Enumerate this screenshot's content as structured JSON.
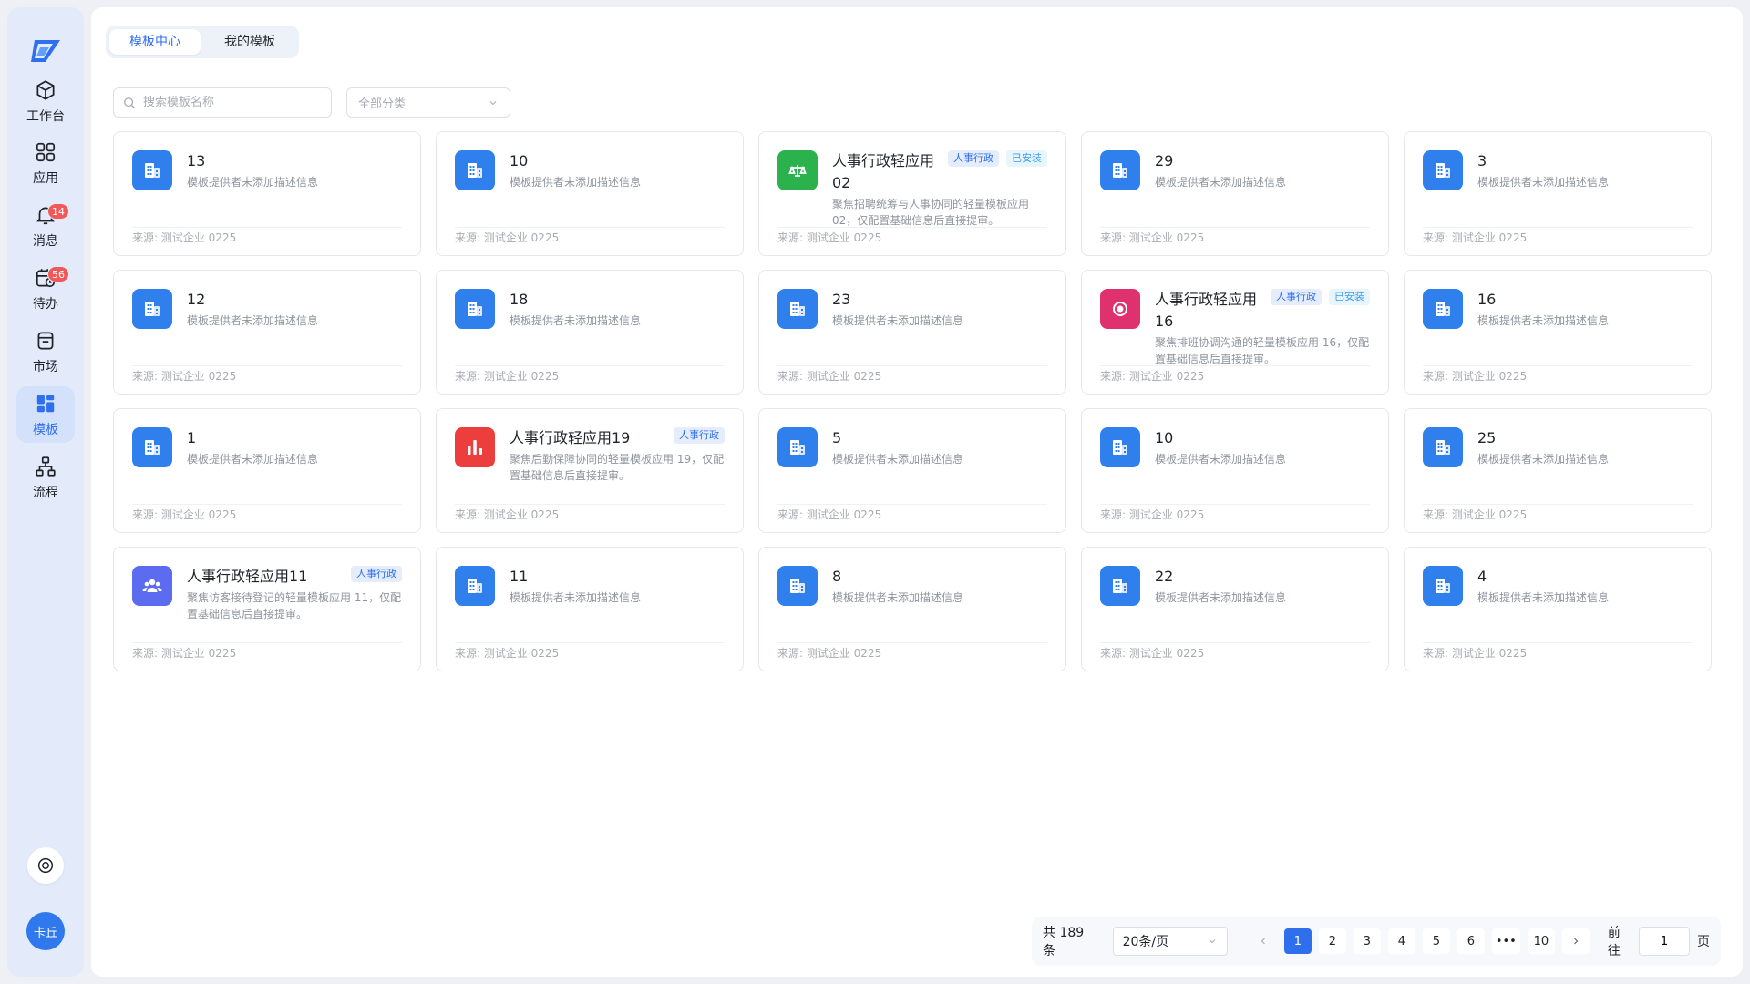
{
  "sidebar": {
    "items": [
      {
        "label": "工作台",
        "icon": "cube-icon"
      },
      {
        "label": "应用",
        "icon": "grid-apps-icon"
      },
      {
        "label": "消息",
        "icon": "bell-icon",
        "badge": "14"
      },
      {
        "label": "待办",
        "icon": "calendar-clock-icon",
        "badge": "56"
      },
      {
        "label": "市场",
        "icon": "store-icon"
      },
      {
        "label": "模板",
        "icon": "template-icon",
        "active": true
      },
      {
        "label": "流程",
        "icon": "flow-icon"
      }
    ],
    "avatar": "卡丘"
  },
  "tabs": [
    {
      "label": "模板中心",
      "active": true
    },
    {
      "label": "我的模板",
      "active": false
    }
  ],
  "search": {
    "placeholder": "搜索模板名称"
  },
  "category": {
    "placeholder": "全部分类"
  },
  "cards": [
    {
      "title": "13",
      "desc": "模板提供者未添加描述信息",
      "source": "来源: 测试企业 0225",
      "icon": "building-icon",
      "color": "#2f80ed"
    },
    {
      "title": "10",
      "desc": "模板提供者未添加描述信息",
      "source": "来源: 测试企业 0225",
      "icon": "building-icon",
      "color": "#2f80ed"
    },
    {
      "title": "人事行政轻应用 02",
      "desc": "聚焦招聘统筹与人事协同的轻量模板应用 02，仅配置基础信息后直接提审。",
      "source": "来源: 测试企业 0225",
      "icon": "scale-icon",
      "color": "#2bb24c",
      "tags": [
        "人事行政",
        "已安装"
      ]
    },
    {
      "title": "29",
      "desc": "模板提供者未添加描述信息",
      "source": "来源: 测试企业 0225",
      "icon": "building-icon",
      "color": "#2f80ed"
    },
    {
      "title": "3",
      "desc": "模板提供者未添加描述信息",
      "source": "来源: 测试企业 0225",
      "icon": "building-icon",
      "color": "#2f80ed"
    },
    {
      "title": "12",
      "desc": "模板提供者未添加描述信息",
      "source": "来源: 测试企业 0225",
      "icon": "building-icon",
      "color": "#2f80ed"
    },
    {
      "title": "18",
      "desc": "模板提供者未添加描述信息",
      "source": "来源: 测试企业 0225",
      "icon": "building-icon",
      "color": "#2f80ed"
    },
    {
      "title": "23",
      "desc": "模板提供者未添加描述信息",
      "source": "来源: 测试企业 0225",
      "icon": "building-icon",
      "color": "#2f80ed"
    },
    {
      "title": "人事行政轻应用 16",
      "desc": "聚焦排班协调沟通的轻量模板应用 16，仅配置基础信息后直接提审。",
      "source": "来源: 测试企业 0225",
      "icon": "target-icon",
      "color": "#e0316f",
      "tags": [
        "人事行政",
        "已安装"
      ]
    },
    {
      "title": "16",
      "desc": "模板提供者未添加描述信息",
      "source": "来源: 测试企业 0225",
      "icon": "building-icon",
      "color": "#2f80ed"
    },
    {
      "title": "1",
      "desc": "模板提供者未添加描述信息",
      "source": "来源: 测试企业 0225",
      "icon": "building-icon",
      "color": "#2f80ed"
    },
    {
      "title": "人事行政轻应用19",
      "desc": "聚焦后勤保障协同的轻量模板应用 19，仅配置基础信息后直接提审。",
      "source": "来源: 测试企业 0225",
      "icon": "bar-chart-icon",
      "color": "#ed3e3e",
      "tags": [
        "人事行政"
      ],
      "oneLine": true
    },
    {
      "title": "5",
      "desc": "模板提供者未添加描述信息",
      "source": "来源: 测试企业 0225",
      "icon": "building-icon",
      "color": "#2f80ed"
    },
    {
      "title": "10",
      "desc": "模板提供者未添加描述信息",
      "source": "来源: 测试企业 0225",
      "icon": "building-icon",
      "color": "#2f80ed"
    },
    {
      "title": "25",
      "desc": "模板提供者未添加描述信息",
      "source": "来源: 测试企业 0225",
      "icon": "building-icon",
      "color": "#2f80ed"
    },
    {
      "title": "人事行政轻应用11",
      "desc": "聚焦访客接待登记的轻量模板应用 11，仅配置基础信息后直接提审。",
      "source": "来源: 测试企业 0225",
      "icon": "users-icon",
      "color": "#5b6cf0",
      "tags": [
        "人事行政"
      ],
      "oneLine": true
    },
    {
      "title": "11",
      "desc": "模板提供者未添加描述信息",
      "source": "来源: 测试企业 0225",
      "icon": "building-icon",
      "color": "#2f80ed"
    },
    {
      "title": "8",
      "desc": "模板提供者未添加描述信息",
      "source": "来源: 测试企业 0225",
      "icon": "building-icon",
      "color": "#2f80ed"
    },
    {
      "title": "22",
      "desc": "模板提供者未添加描述信息",
      "source": "来源: 测试企业 0225",
      "icon": "building-icon",
      "color": "#2f80ed"
    },
    {
      "title": "4",
      "desc": "模板提供者未添加描述信息",
      "source": "来源: 测试企业 0225",
      "icon": "building-icon",
      "color": "#2f80ed"
    }
  ],
  "pagination": {
    "total": "共 189 条",
    "page_size": "20条/页",
    "pages": [
      "1",
      "2",
      "3",
      "4",
      "5",
      "6",
      "•••",
      "10"
    ],
    "current": "1",
    "goto_label": "前往",
    "goto_value": "1",
    "page_suffix": "页"
  }
}
